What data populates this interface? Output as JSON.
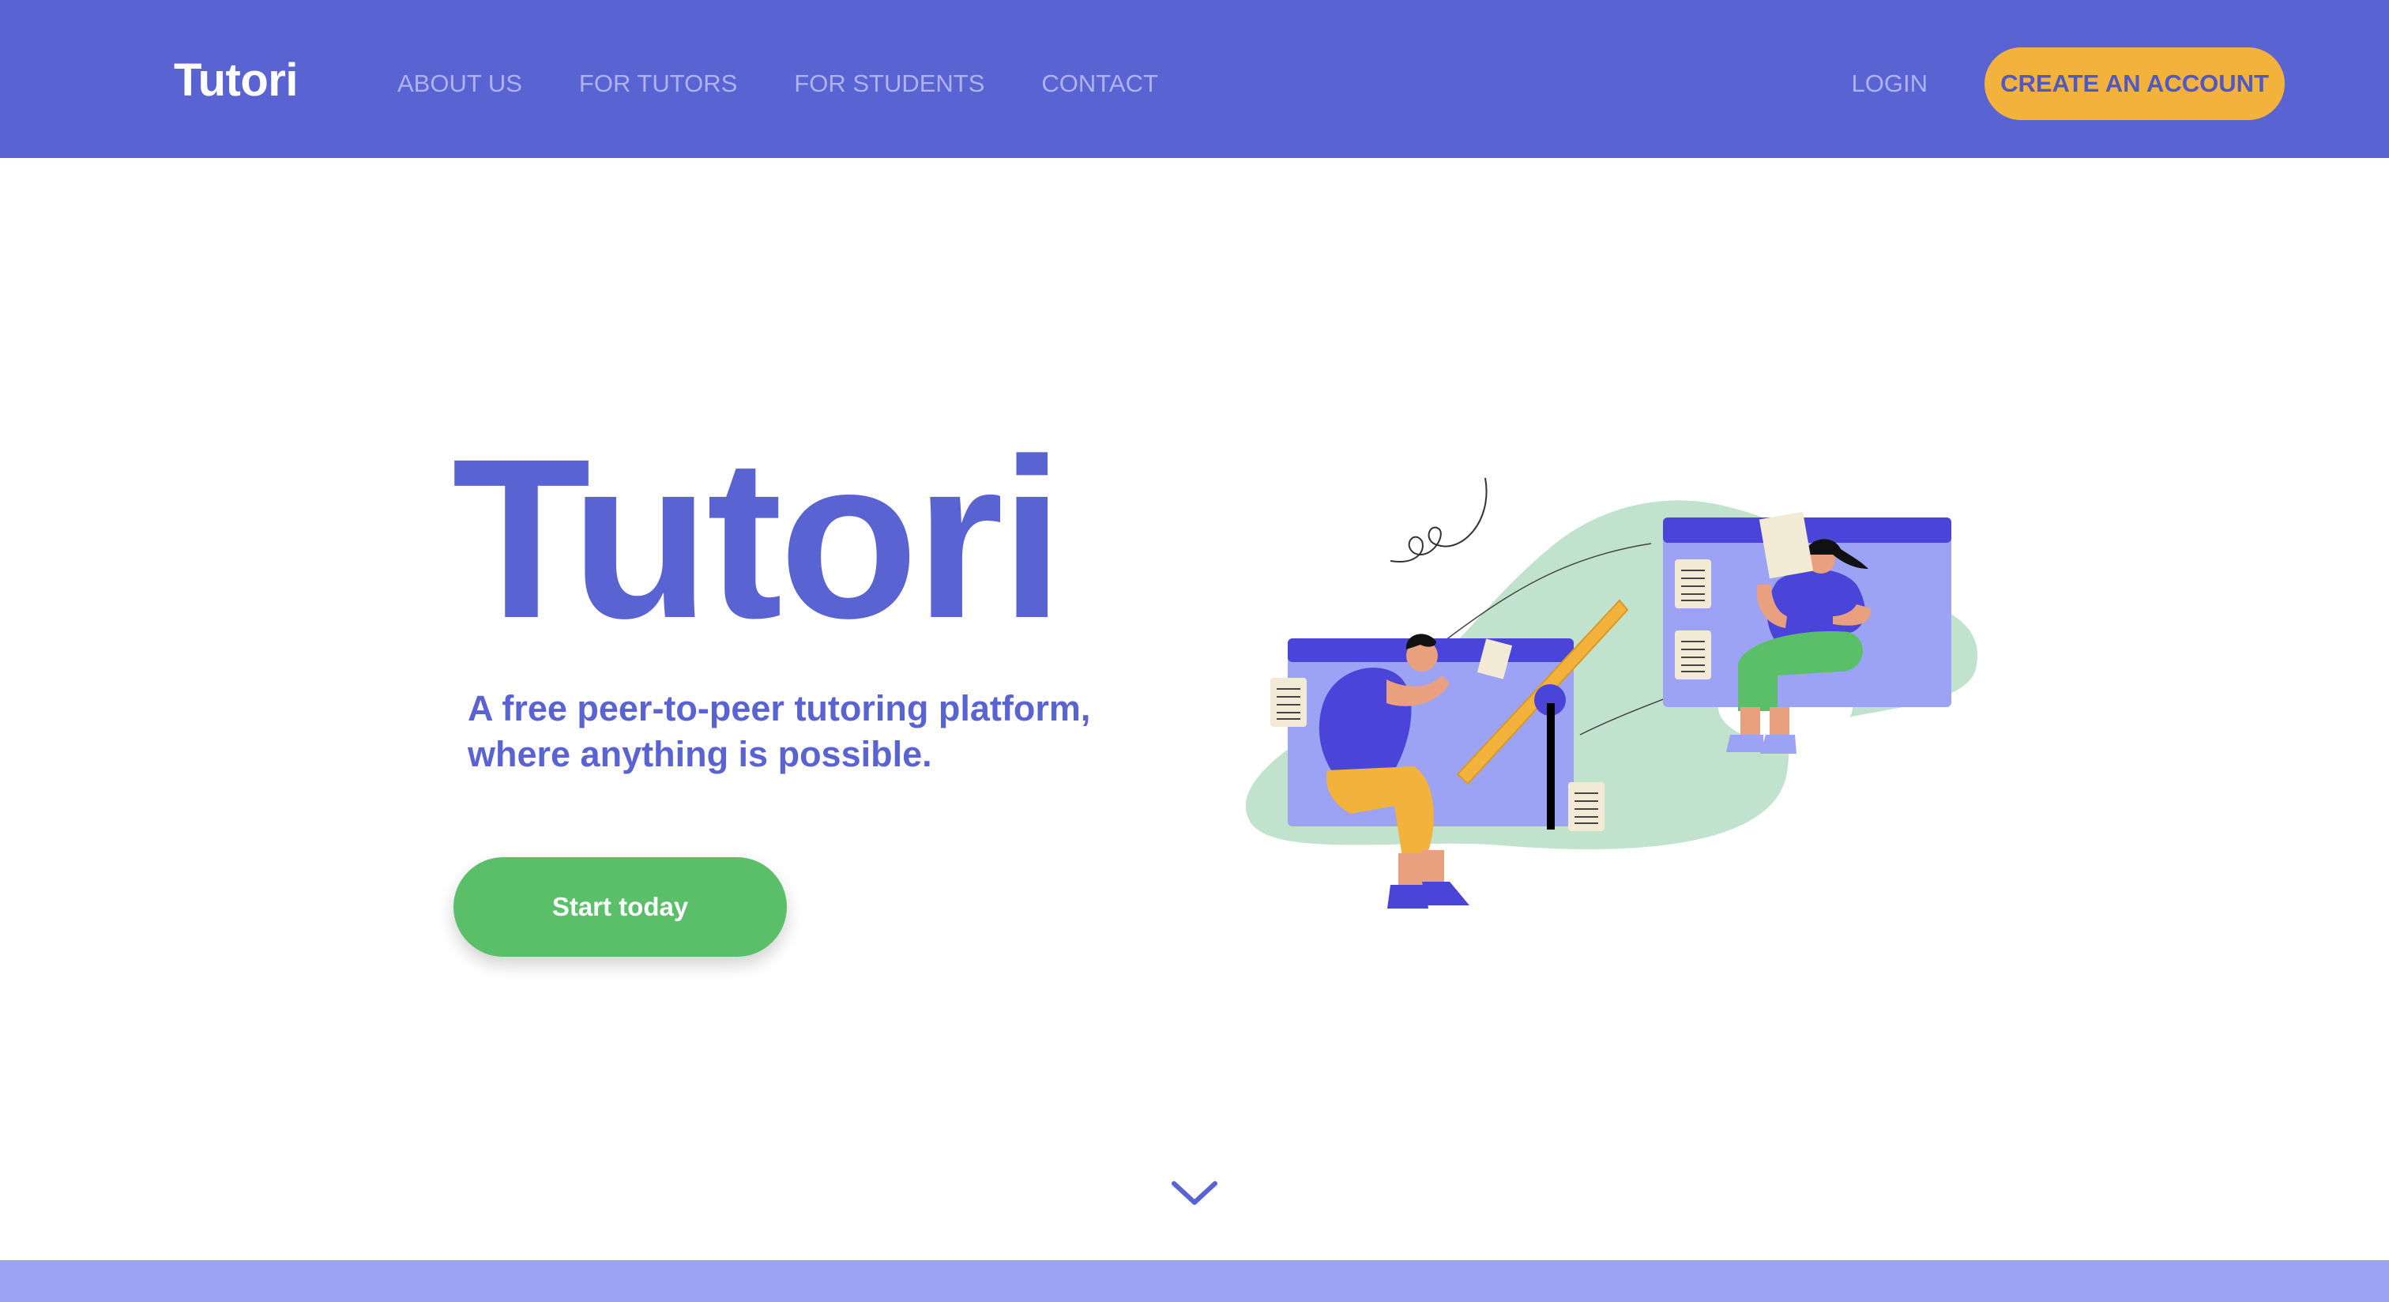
{
  "nav": {
    "brand": "Tutori",
    "links": [
      "ABOUT US",
      "FOR TUTORS",
      "FOR STUDENTS",
      "CONTACT"
    ],
    "login": "LOGIN",
    "create_account": "CREATE AN ACCOUNT"
  },
  "hero": {
    "title": "Tutori",
    "subtitle_line1": "A free peer-to-peer tutoring platform,",
    "subtitle_line2": "where anything is possible.",
    "cta": "Start today"
  },
  "illustration": {
    "name": "tutoring-illustration"
  },
  "colors": {
    "primary": "#5a63d2",
    "accent": "#f3b23b",
    "cta_green": "#5bbf6a",
    "band": "#9da3f4",
    "blob": "#c1e2cd"
  },
  "icons": {
    "scroll": "chevron-down-icon"
  }
}
